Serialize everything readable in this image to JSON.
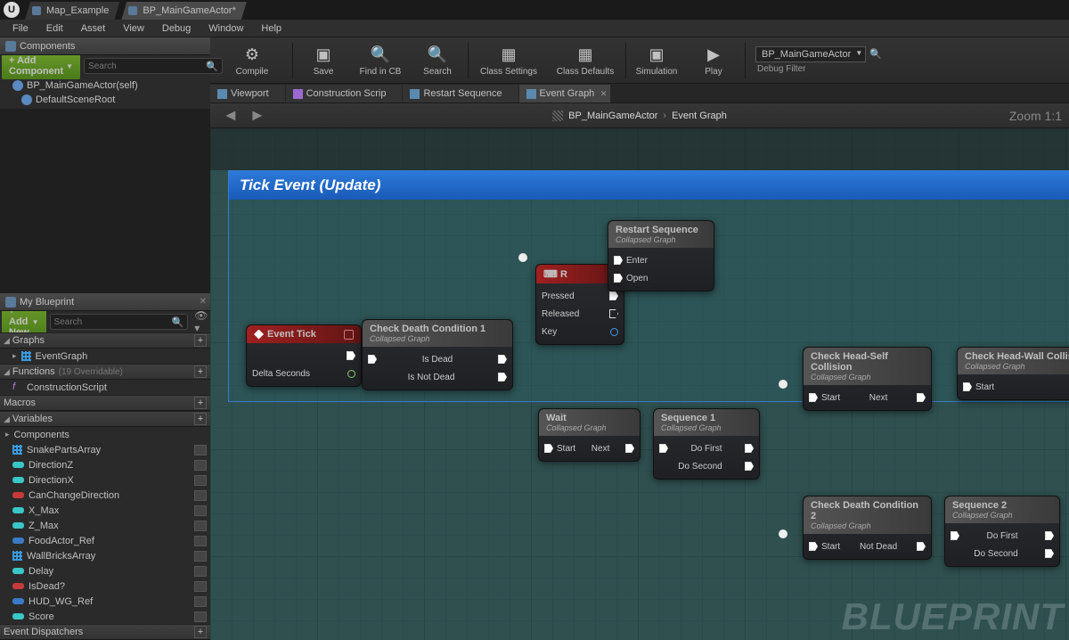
{
  "topTabs": [
    {
      "label": "Map_Example",
      "active": false
    },
    {
      "label": "BP_MainGameActor*",
      "active": true
    }
  ],
  "menu": [
    "File",
    "Edit",
    "Asset",
    "View",
    "Debug",
    "Window",
    "Help"
  ],
  "panels": {
    "components": {
      "title": "Components",
      "addBtn": "+ Add Component",
      "searchPh": "Search"
    },
    "compTree": [
      {
        "label": "BP_MainGameActor(self)",
        "child": false
      },
      {
        "label": "DefaultSceneRoot",
        "child": true
      }
    ],
    "myBlueprint": {
      "title": "My Blueprint",
      "addBtn": "+ Add New",
      "searchPh": "Search"
    }
  },
  "bpCats": {
    "graphs": {
      "label": "Graphs",
      "items": [
        {
          "label": "EventGraph",
          "type": "graph"
        }
      ]
    },
    "functions": {
      "label": "Functions",
      "hint": "(19 Overridable)",
      "items": [
        {
          "label": "ConstructionScript",
          "type": "fn"
        }
      ]
    },
    "macros": {
      "label": "Macros",
      "items": []
    },
    "variables": {
      "label": "Variables",
      "sub": "Components",
      "items": [
        {
          "label": "SnakePartsArray",
          "type": "grid"
        },
        {
          "label": "DirectionZ",
          "type": "pill",
          "color": "cyan"
        },
        {
          "label": "DirectionX",
          "type": "pill",
          "color": "cyan"
        },
        {
          "label": "CanChangeDirection",
          "type": "pill",
          "color": "red"
        },
        {
          "label": "X_Max",
          "type": "pill",
          "color": "cyan"
        },
        {
          "label": "Z_Max",
          "type": "pill",
          "color": "cyan"
        },
        {
          "label": "FoodActor_Ref",
          "type": "pill",
          "color": "blue"
        },
        {
          "label": "WallBricksArray",
          "type": "grid"
        },
        {
          "label": "Delay",
          "type": "pill",
          "color": "cyan"
        },
        {
          "label": "IsDead?",
          "type": "pill",
          "color": "red"
        },
        {
          "label": "HUD_WG_Ref",
          "type": "pill",
          "color": "blue"
        },
        {
          "label": "Score",
          "type": "pill",
          "color": "cyan"
        }
      ]
    },
    "dispatchers": {
      "label": "Event Dispatchers",
      "items": []
    }
  },
  "toolbar": [
    {
      "label": "Compile",
      "icon": "⚙",
      "width": "wide"
    },
    {
      "label": "Save",
      "icon": "▣"
    },
    {
      "label": "Find in CB",
      "icon": "🔍"
    },
    {
      "label": "Search",
      "icon": "🔍"
    },
    {
      "label": "Class Settings",
      "icon": "▦",
      "width": "wide"
    },
    {
      "label": "Class Defaults",
      "icon": "▦",
      "width": "wide"
    },
    {
      "label": "Simulation",
      "icon": "▣"
    },
    {
      "label": "Play",
      "icon": "▶"
    }
  ],
  "toolbarCombo": "BP_MainGameActor",
  "toolbarFilter": "Debug Filter",
  "innerTabs": [
    {
      "label": "Viewport",
      "icon": "vp"
    },
    {
      "label": "Construction Scrip",
      "icon": "fn"
    },
    {
      "label": "Restart Sequence",
      "icon": "vp"
    },
    {
      "label": "Event Graph",
      "icon": "vp",
      "active": true
    }
  ],
  "breadcrumb": {
    "asset": "BP_MainGameActor",
    "graph": "Event Graph"
  },
  "zoom": "Zoom 1:1",
  "comment": "Tick Event (Update)",
  "watermark": "BLUEPRINT",
  "nodes": {
    "eventTick": {
      "title": "Event Tick",
      "delta": "Delta Seconds"
    },
    "cdc1": {
      "title": "Check Death Condition 1",
      "sub": "Collapsed Graph",
      "out1": "Is Dead",
      "out2": "Is Not Dead"
    },
    "keyR": {
      "title": "R",
      "p": "Pressed",
      "r": "Released",
      "k": "Key"
    },
    "rseq": {
      "title": "Restart Sequence",
      "sub": "Collapsed Graph",
      "in1": "Enter",
      "in2": "Open"
    },
    "wait": {
      "title": "Wait",
      "sub": "Collapsed Graph",
      "in": "Start",
      "out": "Next"
    },
    "seq1": {
      "title": "Sequence 1",
      "sub": "Collapsed Graph",
      "o1": "Do First",
      "o2": "Do Second"
    },
    "chsc": {
      "title": "Check Head-Self Collision",
      "sub": "Collapsed Graph",
      "in": "Start",
      "out": "Next"
    },
    "chwc": {
      "title": "Check Head-Wall Collis",
      "sub": "Collapsed Graph",
      "in": "Start"
    },
    "cdc2": {
      "title": "Check Death Condition 2",
      "sub": "Collapsed Graph",
      "in": "Start",
      "out": "Not Dead"
    },
    "seq2": {
      "title": "Sequence 2",
      "sub": "Collapsed Graph",
      "o1": "Do First",
      "o2": "Do Second"
    }
  }
}
